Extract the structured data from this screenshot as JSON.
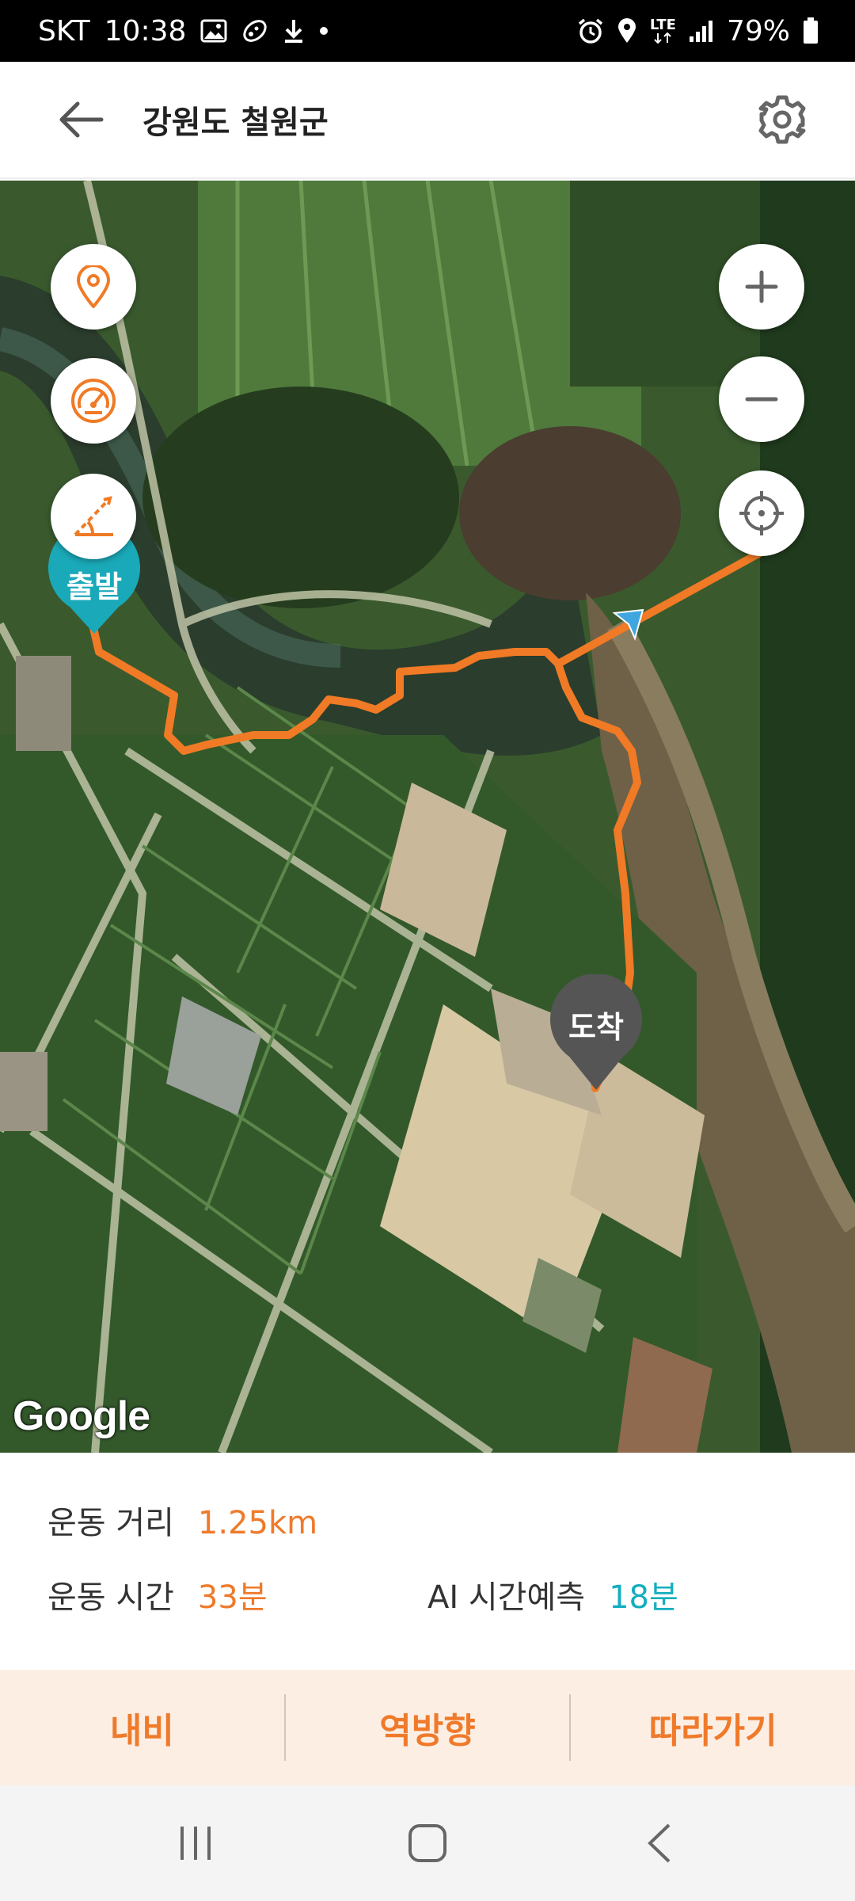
{
  "status_bar": {
    "carrier": "SKT",
    "time": "10:38",
    "network": "LTE",
    "battery": "79%",
    "icons": [
      "gallery-icon",
      "activity-icon",
      "download-icon",
      "dot-icon",
      "alarm-icon",
      "location-icon",
      "lte-icon",
      "signal-icon",
      "battery-icon"
    ]
  },
  "header": {
    "title": "강원도 철원군",
    "back_icon": "arrow-left-icon",
    "settings_icon": "gear-icon"
  },
  "map": {
    "provider_logo": "Google",
    "start_marker_label": "출발",
    "end_marker_label": "도착",
    "route_color": "#f07a25",
    "left_controls": [
      "location-pin-icon",
      "speedometer-icon",
      "angle-icon"
    ],
    "right_controls": [
      "zoom-in-icon",
      "zoom-out-icon",
      "crosshair-icon"
    ]
  },
  "info": {
    "distance_label": "운동 거리",
    "distance_value": "1.25km",
    "time_label": "운동 시간",
    "time_value": "33분",
    "ai_label": "AI 시간예측",
    "ai_value": "18분"
  },
  "actions": {
    "navigate": "내비",
    "reverse": "역방향",
    "follow": "따라가기"
  },
  "nav_bar": {
    "icons": [
      "recent-apps-icon",
      "home-icon",
      "back-icon"
    ]
  },
  "colors": {
    "accent_orange": "#ee7a2b",
    "accent_teal": "#14aebf",
    "action_bar_bg": "#fdeee4",
    "end_marker": "#555555"
  }
}
